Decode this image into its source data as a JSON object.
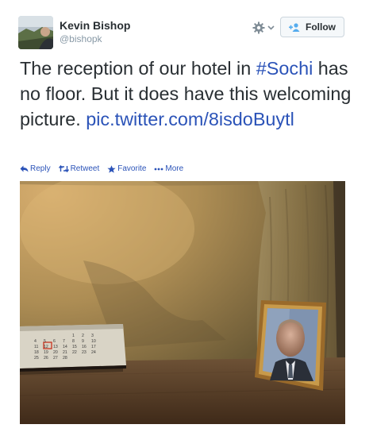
{
  "author": {
    "name": "Kevin Bishop",
    "handle": "@bishopk"
  },
  "follow_label": "Follow",
  "tweet": {
    "text_before": "The reception of our hotel in ",
    "hashtag": "#Sochi",
    "text_after": " has no floor. But it does have this welcoming picture. ",
    "link": "pic.twitter.com/8isdoBuytl"
  },
  "actions": {
    "reply": "Reply",
    "retweet": "Retweet",
    "favorite": "Favorite",
    "more": "More"
  },
  "calendar": {
    "days": [
      "1",
      "2",
      "3",
      "4",
      "5",
      "6",
      "7",
      "8",
      "9",
      "10",
      "11",
      "12",
      "13",
      "14",
      "15",
      "16",
      "17",
      "18",
      "19",
      "20",
      "21",
      "22",
      "23",
      "24",
      "25",
      "26",
      "27",
      "28"
    ]
  }
}
